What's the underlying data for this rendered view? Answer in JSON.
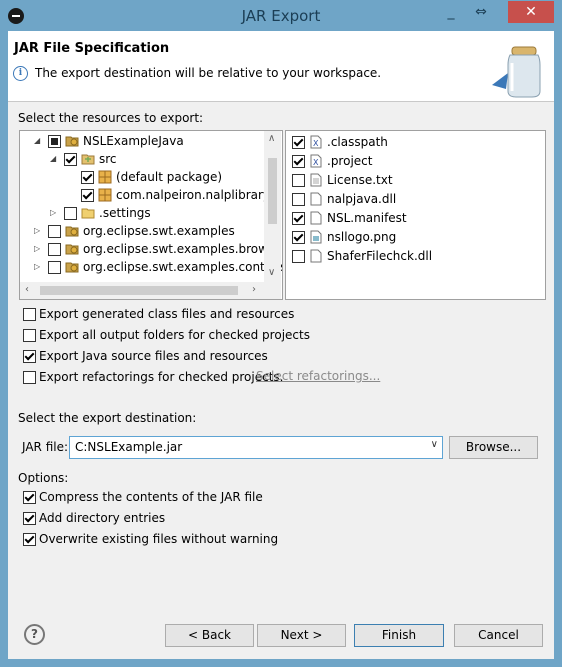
{
  "window": {
    "title": "JAR Export",
    "minimize_glyph": "_",
    "maximize_glyph": "⇔",
    "close_glyph": "✕"
  },
  "banner": {
    "title": "JAR File Specification",
    "message": "The export destination will be relative to your workspace.",
    "info_glyph": "i"
  },
  "resources_label": "Select the resources to export:",
  "tree": [
    {
      "label": "NSLExampleJava",
      "check": "partial",
      "arrow": "◢",
      "icon": "project-icon"
    },
    {
      "label": "src",
      "check": "checked",
      "arrow": "◢",
      "icon": "source-folder-icon"
    },
    {
      "label": "(default package)",
      "check": "checked",
      "icon": "package-icon"
    },
    {
      "label": "com.nalpeiron.nalplibrary",
      "check": "checked",
      "icon": "package-icon"
    },
    {
      "label": ".settings",
      "check": "unchecked",
      "arrow": "▷",
      "icon": "folder-icon"
    },
    {
      "label": "org.eclipse.swt.examples",
      "check": "unchecked",
      "arrow": "▷",
      "icon": "project-icon"
    },
    {
      "label": "org.eclipse.swt.examples.browser",
      "check": "unchecked",
      "arrow": "▷",
      "icon": "project-icon"
    },
    {
      "label": "org.eclipse.swt.examples.controls",
      "check": "unchecked",
      "arrow": "▷",
      "icon": "project-icon"
    }
  ],
  "files": [
    {
      "label": ".classpath",
      "checked": true,
      "icon": "xml-file-icon"
    },
    {
      "label": ".project",
      "checked": true,
      "icon": "xml-file-icon"
    },
    {
      "label": "License.txt",
      "checked": false,
      "icon": "text-file-icon"
    },
    {
      "label": "nalpjava.dll",
      "checked": false,
      "icon": "file-icon"
    },
    {
      "label": "NSL.manifest",
      "checked": true,
      "icon": "file-icon"
    },
    {
      "label": "nsllogo.png",
      "checked": true,
      "icon": "image-file-icon"
    },
    {
      "label": "ShaferFilechck.dll",
      "checked": false,
      "icon": "file-icon"
    }
  ],
  "export_options": [
    {
      "label": "Export generated class files and resources",
      "checked": false
    },
    {
      "label": "Export all output folders for checked projects",
      "checked": false
    },
    {
      "label": "Export Java source files and resources",
      "checked": true
    },
    {
      "label": "Export refactorings for checked projects.",
      "checked": false
    }
  ],
  "select_refactorings_link": "Select refactorings...",
  "destination_label": "Select the export destination:",
  "jar_file": {
    "label": "JAR file:",
    "value": "C:NSLExample.jar",
    "browse": "Browse..."
  },
  "options_label": "Options:",
  "options": [
    {
      "label": "Compress the contents of the JAR file",
      "checked": true
    },
    {
      "label": "Add directory entries",
      "checked": true
    },
    {
      "label": "Overwrite existing files without warning",
      "checked": true
    }
  ],
  "buttons": {
    "help": "?",
    "back": "< Back",
    "next": "Next >",
    "finish": "Finish",
    "cancel": "Cancel"
  },
  "colors": {
    "title_bar": "#6fa5c7",
    "close_button": "#c7504c",
    "link": "#8a8a8a"
  }
}
